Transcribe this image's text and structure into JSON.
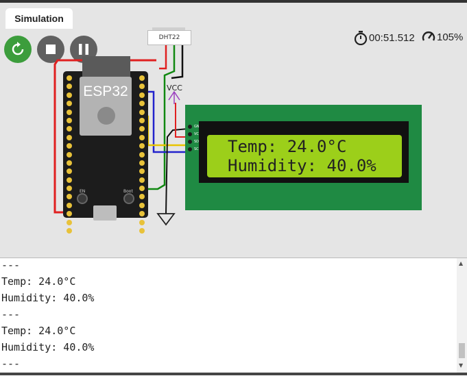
{
  "tab": {
    "label": "Simulation"
  },
  "controls": {
    "restart": "restart-icon",
    "stop": "stop-icon",
    "pause": "pause-icon"
  },
  "status": {
    "timer": "00:51.512",
    "speed": "105%"
  },
  "board": {
    "label": "ESP32",
    "boot_label": "Boot",
    "en_label": "EN"
  },
  "sensor": {
    "label": "DHT22"
  },
  "power": {
    "label": "VCC"
  },
  "lcd": {
    "line1": "Temp: 24.0°C",
    "line2": "Humidity: 40.0%",
    "pins": [
      "GND",
      "VCC",
      "SDA",
      "SCL"
    ]
  },
  "serial": {
    "lines": [
      "---",
      "Temp: 24.0°C",
      "Humidity: 40.0%",
      "---",
      "Temp: 24.0°C",
      "Humidity: 40.0%",
      "---"
    ]
  },
  "colors": {
    "restart": "#3c9d3c",
    "wire_red": "#e02020",
    "wire_green": "#118811",
    "wire_blue": "#2222cc",
    "wire_yellow": "#e8c400",
    "lcd_board": "#1f8a43",
    "lcd_screen": "#9ccf1a"
  }
}
